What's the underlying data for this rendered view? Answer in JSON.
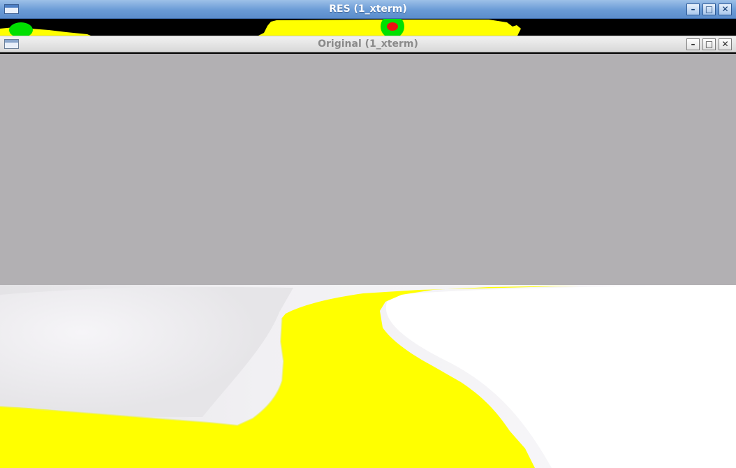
{
  "res_window": {
    "title": "RES (1_xterm)",
    "buttons": {
      "minimize": "–",
      "maximize": "□",
      "close": "✕"
    },
    "colors": {
      "background": "#000000",
      "blob": "#ffff00",
      "marker_outer": "#00e000",
      "marker_inner": "#ee1111"
    }
  },
  "original_window": {
    "title": "Original (1_xterm)",
    "buttons": {
      "minimize": "–",
      "maximize": "□",
      "close": "✕"
    },
    "colors": {
      "sky": "#b2b0b3",
      "ground": "#f4f3f6",
      "path": "#ffff00"
    }
  }
}
